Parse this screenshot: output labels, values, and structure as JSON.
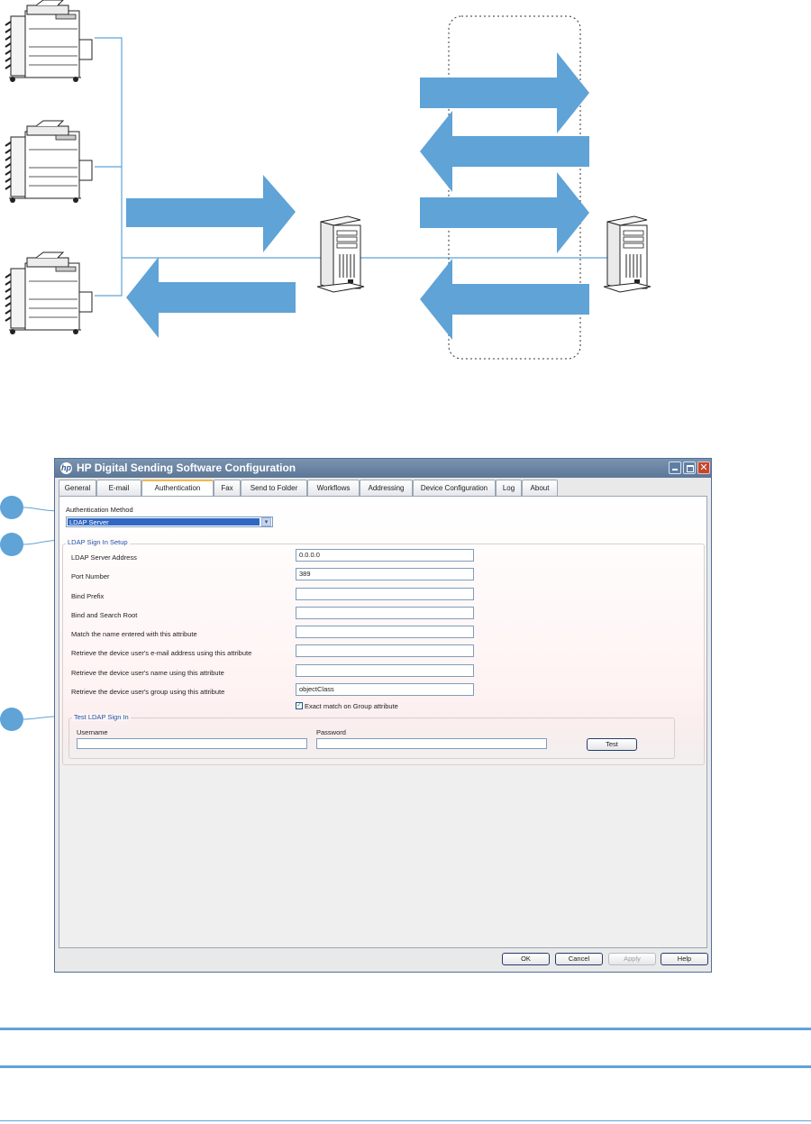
{
  "colors": {
    "accent": "#5fa3d7",
    "window_title_bar": "#5c7797",
    "section_title": "#1f55a8"
  },
  "diagram": {
    "icons": [
      "multifunction-printer-icon",
      "multifunction-printer-icon",
      "multifunction-printer-icon",
      "server-icon",
      "server-icon"
    ]
  },
  "dialog": {
    "title": "HP Digital Sending Software Configuration",
    "tabs": [
      {
        "label": "General"
      },
      {
        "label": "E-mail"
      },
      {
        "label": "Authentication"
      },
      {
        "label": "Fax"
      },
      {
        "label": "Send to Folder"
      },
      {
        "label": "Workflows"
      },
      {
        "label": "Addressing"
      },
      {
        "label": "Device Configuration"
      },
      {
        "label": "Log"
      },
      {
        "label": "About"
      }
    ],
    "auth_method": {
      "label": "Authentication Method",
      "value": "LDAP Server"
    },
    "ldap_setup": {
      "title": "LDAP Sign In Setup",
      "rows": [
        {
          "label": "LDAP Server Address",
          "value": "0.0.0.0"
        },
        {
          "label": "Port Number",
          "value": "389"
        },
        {
          "label": "Bind Prefix",
          "value": ""
        },
        {
          "label": "Bind and Search Root",
          "value": ""
        },
        {
          "label": "Match the name entered with this attribute",
          "value": ""
        },
        {
          "label": "Retrieve the device user's e-mail address using this attribute",
          "value": ""
        },
        {
          "label": "Retrieve the device user's name using this attribute",
          "value": ""
        },
        {
          "label": "Retrieve the device user's group using this attribute",
          "value": "objectClass"
        }
      ],
      "exact_match": {
        "label": "Exact match on Group attribute",
        "checked": true
      }
    },
    "test_ldap": {
      "title": "Test LDAP Sign In",
      "username_label": "Username",
      "username_value": "",
      "password_label": "Password",
      "password_value": "",
      "test_label": "Test"
    },
    "buttons": {
      "ok": "OK",
      "cancel": "Cancel",
      "apply": "Apply",
      "help": "Help"
    }
  }
}
